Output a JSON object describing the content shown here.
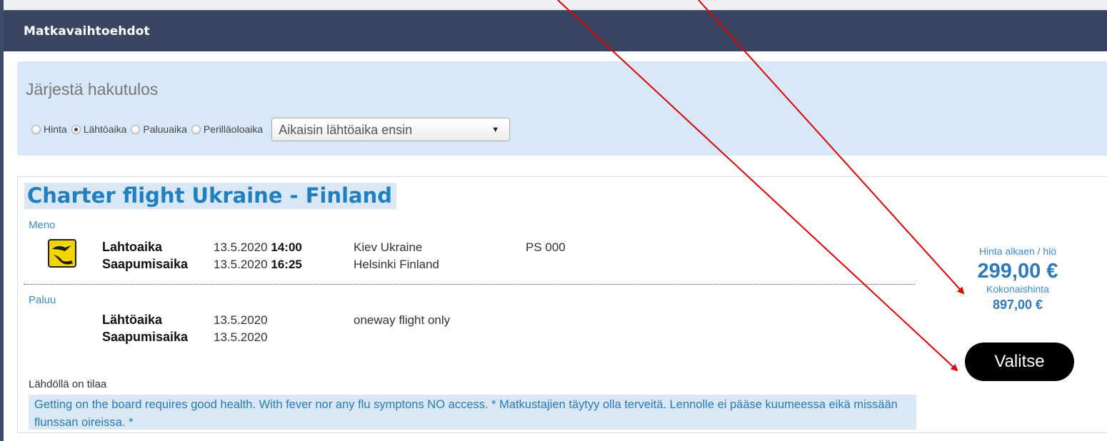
{
  "header": {
    "title": "Matkavaihtoehdot"
  },
  "sort": {
    "title": "Järjestä hakutulos",
    "options": [
      {
        "label": "Hinta",
        "checked": false
      },
      {
        "label": "Lähtöaika",
        "checked": true
      },
      {
        "label": "Paluuaika",
        "checked": false
      },
      {
        "label": "Perilläoloaika",
        "checked": false
      }
    ],
    "select_value": "Aikaisin lähtöaika ensin"
  },
  "result": {
    "title": "Charter flight Ukraine - Finland",
    "outbound": {
      "label": "Meno",
      "departure_label": "Lahtoaika",
      "departure_date": "13.5.2020",
      "departure_time": "14:00",
      "departure_place": "Kiev Ukraine",
      "flight_no": "PS 000",
      "arrival_label": "Saapumisaika",
      "arrival_date": "13.5.2020",
      "arrival_time": "16:25",
      "arrival_place": "Helsinki Finland"
    },
    "return": {
      "label": "Paluu",
      "departure_label": "Lähtöaika",
      "departure_date": "13.5.2020",
      "note": "oneway flight only",
      "arrival_label": "Saapumisaika",
      "arrival_date": "13.5.2020"
    },
    "availability": "Lähdöllä on tilaa",
    "notice": "Getting on the board requires good health. With fever nor any flu symptons NO access. * Matkustajien täytyy olla terveitä. Lennolle ei pääse kuumeessa eikä missään flunssan oireissa. *",
    "price": {
      "from_label": "Hinta alkaen / hlö",
      "per_person": "299,00 €",
      "total_label": "Kokonaishinta",
      "total": "897,00 €"
    },
    "select_button": "Valitse"
  },
  "colors": {
    "header_bg": "#3a4563",
    "panel_bg": "#d8e8f8",
    "title_blue": "#1f7fc0",
    "price_blue": "#2d79b9",
    "arrow_red": "#e00000"
  },
  "icons": {
    "airline_logo": "airline-logo-icon",
    "dropdown": "chevron-down-icon"
  }
}
